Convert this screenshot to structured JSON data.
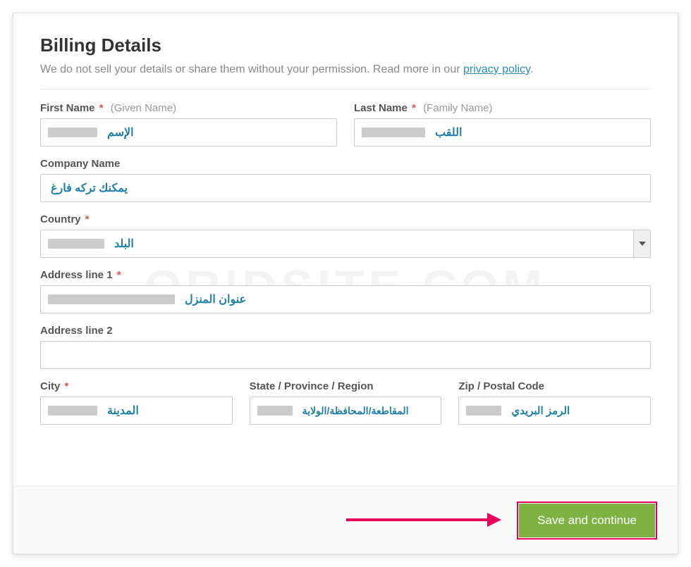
{
  "header": {
    "title": "Billing Details",
    "subtitle_pre": "We do not sell your details or share them without your permission. Read more in our ",
    "privacy_link": "privacy policy",
    "subtitle_post": "."
  },
  "fields": {
    "first_name": {
      "label": "First Name",
      "hint": "(Given Name)",
      "annot": "الإسم"
    },
    "last_name": {
      "label": "Last Name",
      "hint": "(Family Name)",
      "annot": "اللقب"
    },
    "company": {
      "label": "Company Name",
      "annot": "يمكنك تركه فارغ"
    },
    "country": {
      "label": "Country",
      "annot": "البلد"
    },
    "address1": {
      "label": "Address line 1",
      "annot": "عنوان المنزل"
    },
    "address2": {
      "label": "Address line 2"
    },
    "city": {
      "label": "City",
      "annot": "المدينة"
    },
    "state": {
      "label": "State / Province / Region",
      "annot": "المقاطعة/المحافظة/الولاية"
    },
    "zip": {
      "label": "Zip / Postal Code",
      "annot": "الرمز البريدي"
    }
  },
  "required_mark": "*",
  "watermark": "ORIDSITE.COM",
  "footer": {
    "save_label": "Save and continue"
  }
}
